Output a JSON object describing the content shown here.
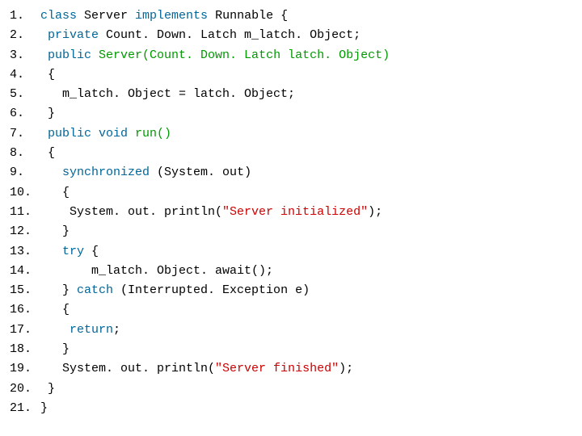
{
  "code": {
    "lines": [
      {
        "num": "1.",
        "frags": [
          {
            "cls": "tok-kw",
            "t": "class "
          },
          {
            "cls": "tok-plain",
            "t": "Server "
          },
          {
            "cls": "tok-kw",
            "t": "implements "
          },
          {
            "cls": "tok-plain",
            "t": "Runnable {"
          }
        ]
      },
      {
        "num": "2.",
        "frags": [
          {
            "cls": "tok-plain",
            "t": " "
          },
          {
            "cls": "tok-kw",
            "t": "private "
          },
          {
            "cls": "tok-plain",
            "t": "Count. Down. Latch m_latch. Object;"
          }
        ]
      },
      {
        "num": "3.",
        "frags": [
          {
            "cls": "tok-plain",
            "t": " "
          },
          {
            "cls": "tok-kw",
            "t": "public "
          },
          {
            "cls": "tok-meth",
            "t": "Server(Count. Down. Latch latch. Object)"
          }
        ]
      },
      {
        "num": "4.",
        "frags": [
          {
            "cls": "tok-plain",
            "t": " {"
          }
        ]
      },
      {
        "num": "5.",
        "frags": [
          {
            "cls": "tok-plain",
            "t": "   m_latch. Object = latch. Object;"
          }
        ]
      },
      {
        "num": "6.",
        "frags": [
          {
            "cls": "tok-plain",
            "t": " }"
          }
        ]
      },
      {
        "num": "7.",
        "frags": [
          {
            "cls": "tok-plain",
            "t": " "
          },
          {
            "cls": "tok-kw",
            "t": "public void "
          },
          {
            "cls": "tok-meth",
            "t": "run()"
          }
        ]
      },
      {
        "num": "8.",
        "frags": [
          {
            "cls": "tok-plain",
            "t": " {"
          }
        ]
      },
      {
        "num": "9.",
        "frags": [
          {
            "cls": "tok-plain",
            "t": "   "
          },
          {
            "cls": "tok-kw",
            "t": "synchronized "
          },
          {
            "cls": "tok-plain",
            "t": "(System. out)"
          }
        ]
      },
      {
        "num": "10.",
        "frags": [
          {
            "cls": "tok-plain",
            "t": "   {"
          }
        ]
      },
      {
        "num": "11.",
        "frags": [
          {
            "cls": "tok-plain",
            "t": "    System. out. println("
          },
          {
            "cls": "tok-str",
            "t": "\"Server initialized\""
          },
          {
            "cls": "tok-plain",
            "t": ");"
          }
        ]
      },
      {
        "num": "12.",
        "frags": [
          {
            "cls": "tok-plain",
            "t": "   }"
          }
        ]
      },
      {
        "num": "13.",
        "frags": [
          {
            "cls": "tok-plain",
            "t": "   "
          },
          {
            "cls": "tok-kw",
            "t": "try"
          },
          {
            "cls": "tok-plain",
            "t": " {"
          }
        ]
      },
      {
        "num": "14.",
        "frags": [
          {
            "cls": "tok-plain",
            "t": "       m_latch. Object. await();"
          }
        ]
      },
      {
        "num": "15.",
        "frags": [
          {
            "cls": "tok-plain",
            "t": "   } "
          },
          {
            "cls": "tok-kw",
            "t": "catch "
          },
          {
            "cls": "tok-plain",
            "t": "(Interrupted. Exception e)"
          }
        ]
      },
      {
        "num": "16.",
        "frags": [
          {
            "cls": "tok-plain",
            "t": "   {"
          }
        ]
      },
      {
        "num": "17.",
        "frags": [
          {
            "cls": "tok-plain",
            "t": "    "
          },
          {
            "cls": "tok-kw",
            "t": "return"
          },
          {
            "cls": "tok-plain",
            "t": ";"
          }
        ]
      },
      {
        "num": "18.",
        "frags": [
          {
            "cls": "tok-plain",
            "t": "   }"
          }
        ]
      },
      {
        "num": "19.",
        "frags": [
          {
            "cls": "tok-plain",
            "t": "   System. out. println("
          },
          {
            "cls": "tok-str",
            "t": "\"Server finished\""
          },
          {
            "cls": "tok-plain",
            "t": ");"
          }
        ]
      },
      {
        "num": "20.",
        "frags": [
          {
            "cls": "tok-plain",
            "t": " }"
          }
        ]
      },
      {
        "num": "21.",
        "frags": [
          {
            "cls": "tok-plain",
            "t": "}"
          }
        ]
      }
    ]
  }
}
